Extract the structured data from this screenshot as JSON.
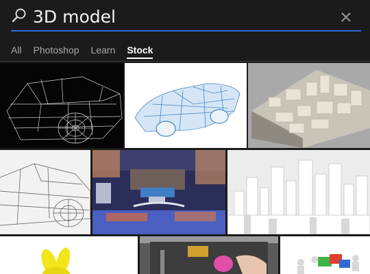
{
  "search": {
    "query": "3D model",
    "icon": "search-icon",
    "clear_icon": "close-icon"
  },
  "tabs": [
    {
      "label": "All",
      "active": false
    },
    {
      "label": "Photoshop",
      "active": false
    },
    {
      "label": "Learn",
      "active": false
    },
    {
      "label": "Stock",
      "active": true
    }
  ],
  "colors": {
    "background": "#1b1b1b",
    "accent": "#2d6bd8",
    "tab_inactive": "#a8a8a8",
    "tab_active": "#ffffff"
  },
  "results": [
    {
      "subject": "wireframe-car-dark",
      "selected": true
    },
    {
      "subject": "blue-wireframe-car"
    },
    {
      "subject": "white-city-block-model"
    },
    {
      "subject": "car-wireframe-sketch"
    },
    {
      "subject": "3d-printer-closeup"
    },
    {
      "subject": "white-skyscraper-city"
    },
    {
      "subject": "yellow-bunny-print"
    },
    {
      "subject": "3d-printer-hands"
    },
    {
      "subject": "puzzle-figures"
    }
  ]
}
